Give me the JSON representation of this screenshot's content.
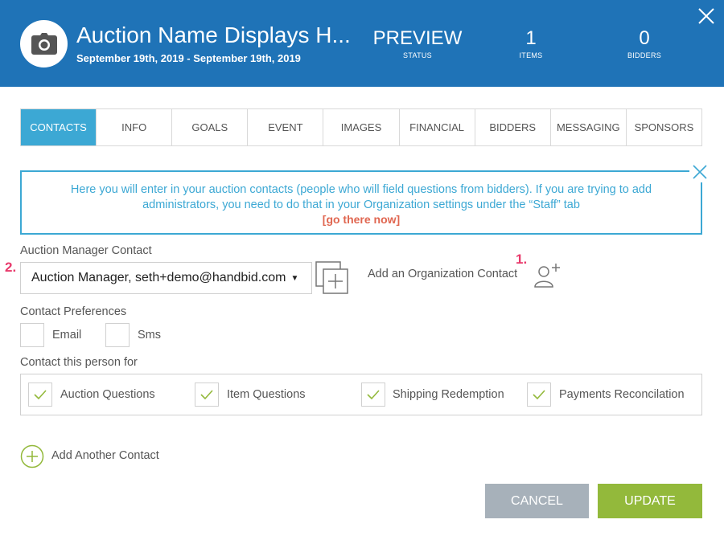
{
  "header": {
    "title": "Auction Name Displays H...",
    "dates": "September 19th, 2019 - September 19th, 2019",
    "stats": [
      {
        "value": "PREVIEW",
        "label": "STATUS"
      },
      {
        "value": "1",
        "label": "ITEMS"
      },
      {
        "value": "0",
        "label": "BIDDERS"
      }
    ],
    "brand_color": "#1f73b7"
  },
  "tabs": [
    "CONTACTS",
    "INFO",
    "GOALS",
    "EVENT",
    "IMAGES",
    "FINANCIAL",
    "BIDDERS",
    "MESSAGING",
    "SPONSORS"
  ],
  "active_tab": "CONTACTS",
  "notice": {
    "text": "Here you will enter in your auction contacts (people who will field questions from bidders). If you are trying to add administrators, you need to do that in your Organization settings under the “Staff” tab",
    "link": "[go there now]"
  },
  "manager": {
    "label": "Auction Manager Contact",
    "selected": "Auction Manager, seth+demo@handbid.com",
    "add_org_label": "Add an Organization Contact"
  },
  "annotations": {
    "one": "1.",
    "two": "2."
  },
  "preferences": {
    "label": "Contact Preferences",
    "options": [
      {
        "label": "Email",
        "checked": false
      },
      {
        "label": "Sms",
        "checked": false
      }
    ]
  },
  "purposes": {
    "label": "Contact this person for",
    "options": [
      {
        "label": "Auction Questions",
        "checked": true
      },
      {
        "label": "Item Questions",
        "checked": true
      },
      {
        "label": "Shipping Redemption",
        "checked": true
      },
      {
        "label": "Payments Reconcilation",
        "checked": true
      }
    ]
  },
  "add_contact_label": "Add Another Contact",
  "buttons": {
    "cancel": "CANCEL",
    "update": "UPDATE"
  },
  "colors": {
    "accent": "#3ca8d4",
    "link": "#e06650",
    "update": "#93b93b",
    "cancel": "#a7b1ba",
    "badge": "#e8396b"
  }
}
